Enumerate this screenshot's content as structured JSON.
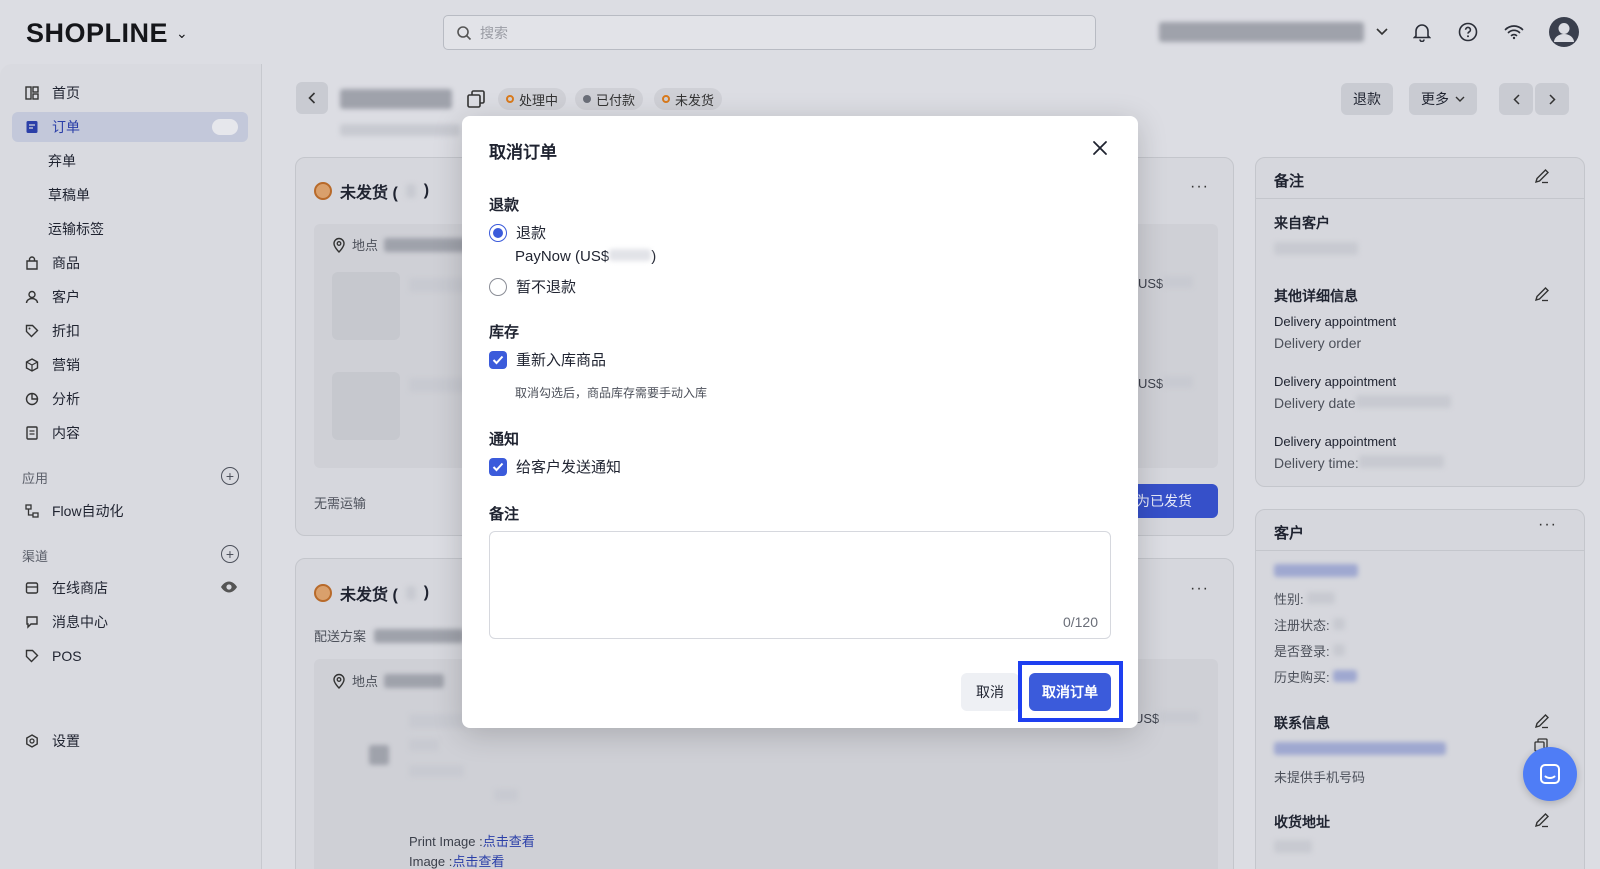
{
  "topbar": {
    "logo": "SHOPLINE",
    "search_placeholder": "搜索"
  },
  "sidebar": {
    "items": [
      {
        "label": "首页"
      },
      {
        "label": "订单"
      },
      {
        "label": "弃单"
      },
      {
        "label": "草稿单"
      },
      {
        "label": "运输标签"
      },
      {
        "label": "商品"
      },
      {
        "label": "客户"
      },
      {
        "label": "折扣"
      },
      {
        "label": "营销"
      },
      {
        "label": "分析"
      },
      {
        "label": "内容"
      }
    ],
    "apps_section": "应用",
    "apps": [
      {
        "label": "Flow自动化"
      }
    ],
    "channels_section": "渠道",
    "channels": [
      {
        "label": "在线商店"
      },
      {
        "label": "消息中心"
      },
      {
        "label": "POS"
      }
    ],
    "settings": "设置"
  },
  "header": {
    "statuses": [
      {
        "label": "处理中",
        "color": "#d97a1c"
      },
      {
        "label": "已付款",
        "color": "#6b6f79"
      },
      {
        "label": "未发货",
        "color": "#d97a1c"
      }
    ],
    "refund_button": "退款",
    "more_button": "更多"
  },
  "main": {
    "card1": {
      "title": "未发货 (",
      "title_end": ")",
      "location_label": "地点",
      "price_prefix_1": "US$",
      "price_prefix_2": "US$",
      "no_shipping": "无需运输",
      "mark_shipped": "记为已发货"
    },
    "card2": {
      "title": "未发货 (",
      "title_end": ")",
      "delivery_plan": "配送方案",
      "location_label": "地点",
      "price_prefix": "US$",
      "print_image_label": "Print Image :",
      "print_image_link": "点击查看",
      "image_label": "Image :",
      "image_link": "点击查看"
    }
  },
  "right": {
    "notes_title": "备注",
    "from_customer": "来自客户",
    "other_details_title": "其他详细信息",
    "details": [
      {
        "line1": "Delivery appointment",
        "line2": "Delivery order"
      },
      {
        "line1": "Delivery appointment",
        "line2": "Delivery date"
      },
      {
        "line1": "Delivery appointment",
        "line2": "Delivery time:"
      }
    ],
    "customer_title": "客户",
    "customer_fields": [
      {
        "label": "性别:"
      },
      {
        "label": "注册状态:"
      },
      {
        "label": "是否登录:"
      },
      {
        "label": "历史购买:"
      }
    ],
    "contact_title": "联系信息",
    "no_phone": "未提供手机号码",
    "address_title": "收货地址"
  },
  "modal": {
    "title": "取消订单",
    "refund_section": "退款",
    "refund_option": "退款",
    "refund_method": "PayNow (US$",
    "refund_method_end": ")",
    "no_refund_option": "暂不退款",
    "inventory_section": "库存",
    "restock_option": "重新入库商品",
    "restock_hint": "取消勾选后，商品库存需要手动入库",
    "notify_section": "通知",
    "notify_option": "给客户发送通知",
    "notes_section": "备注",
    "counter": "0/120",
    "cancel_button": "取消",
    "confirm_button": "取消订单",
    "refund_selected": true,
    "restock_checked": true,
    "notify_checked": true
  }
}
